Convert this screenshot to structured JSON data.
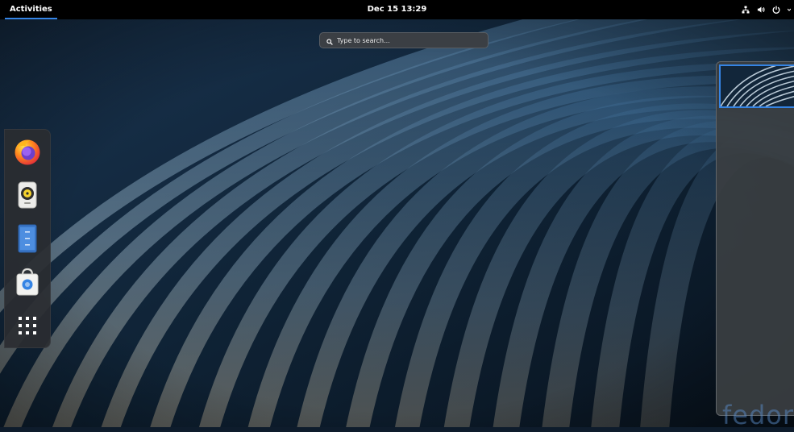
{
  "topbar": {
    "activities_label": "Activities",
    "clock": "Dec 15  13:29",
    "tray_icons": [
      "network-icon",
      "volume-icon",
      "power-icon",
      "chevron-down-icon"
    ]
  },
  "search": {
    "placeholder": "Type to search..."
  },
  "dash": {
    "apps": [
      {
        "name": "Firefox",
        "icon": "firefox-icon"
      },
      {
        "name": "Rhythmbox",
        "icon": "rhythmbox-icon"
      },
      {
        "name": "Files",
        "icon": "files-icon"
      },
      {
        "name": "Software",
        "icon": "software-icon"
      },
      {
        "name": "Show Applications",
        "icon": "app-grid-icon"
      }
    ]
  },
  "workspaces": {
    "count": 1,
    "active": 1
  },
  "watermark": {
    "text": "fedora"
  },
  "colors": {
    "accent": "#3584e4",
    "topbar": "#000000",
    "dash": "#2a2d31"
  }
}
